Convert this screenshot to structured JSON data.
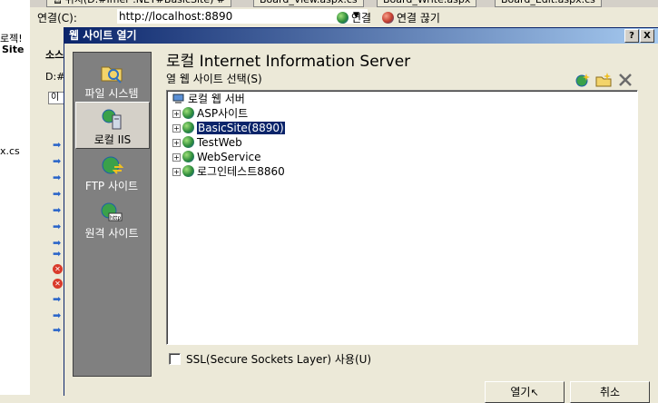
{
  "background": {
    "tabs": [
      "웹 위치(D:#Imer .NET#BasicSite) #",
      "Board_View.aspx.cs",
      "Board_Write.aspx",
      "Board_Edit.aspx.cs"
    ],
    "left_fragments": [
      "로젝!",
      "Site",
      "x.cs"
    ],
    "panel_fragments": [
      "소스",
      "D:#",
      "이"
    ],
    "url_label": "연결(C):",
    "url_value": "http://localhost:8890",
    "connect_label": "연결",
    "disconnect_label": "연결 끊기"
  },
  "dialog": {
    "title": "웹 사이트 열기",
    "help_btn": "?",
    "close_btn": "X",
    "heading": "로컬 Internet Information Server",
    "select_label": "열 웹 사이트 선택(S)",
    "nav": [
      {
        "label": "파일 시스템",
        "icon": "folder-icon"
      },
      {
        "label": "로컬 IIS",
        "icon": "iis-server-icon"
      },
      {
        "label": "FTP 사이트",
        "icon": "ftp-globe-icon"
      },
      {
        "label": "원격 사이트",
        "icon": "http-globe-icon"
      }
    ],
    "tree": {
      "root": "로컬 웹 서버",
      "items": [
        "ASP사이트",
        "BasicSite(8890)",
        "TestWeb",
        "WebService",
        "로그인테스트8860"
      ],
      "selected": "BasicSite(8890)"
    },
    "ssl_label": "SSL(Secure Sockets Layer) 사용(U)",
    "ssl_checked": false,
    "open_btn": "열기",
    "cancel_btn": "취소"
  }
}
